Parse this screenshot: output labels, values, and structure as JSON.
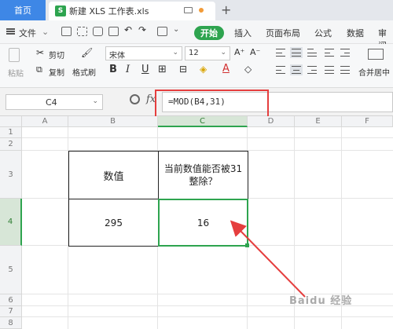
{
  "titlebar": {
    "home_tab": "首页",
    "app_logo": "S",
    "doc_tab_title": "新建 XLS 工作表.xls",
    "new_tab": "+"
  },
  "menubar": {
    "file_label": "文件",
    "start_label": "开始",
    "tabs": [
      "插入",
      "页面布局",
      "公式",
      "数据",
      "审阅"
    ]
  },
  "ribbon": {
    "paste_label": "粘贴",
    "cut_label": "剪切",
    "copy_label": "复制",
    "format_painter_label": "格式刷",
    "font_name": "宋体",
    "font_size": "12",
    "bold": "B",
    "italic": "I",
    "underline": "U",
    "increase_font": "A⁺",
    "decrease_font": "A⁻",
    "merge_label": "合并居中"
  },
  "formula_bar": {
    "name_box": "C4",
    "fx_label": "fx",
    "formula": "=MOD(B4,31)"
  },
  "grid": {
    "columns": [
      "A",
      "B",
      "C",
      "D",
      "E",
      "F"
    ],
    "rows": [
      "1",
      "2",
      "3",
      "4",
      "5",
      "6",
      "7",
      "8"
    ],
    "selected_cell": "C4",
    "cells": {
      "b3": "数值",
      "c3": "当前数值能否被31整除？",
      "b4": "295",
      "c4": "16"
    }
  },
  "watermark": "Baidu 经验",
  "colors": {
    "accent_green": "#2ea44f",
    "home_tab_blue": "#3e87e6",
    "annotation_red": "#e53e3e"
  }
}
